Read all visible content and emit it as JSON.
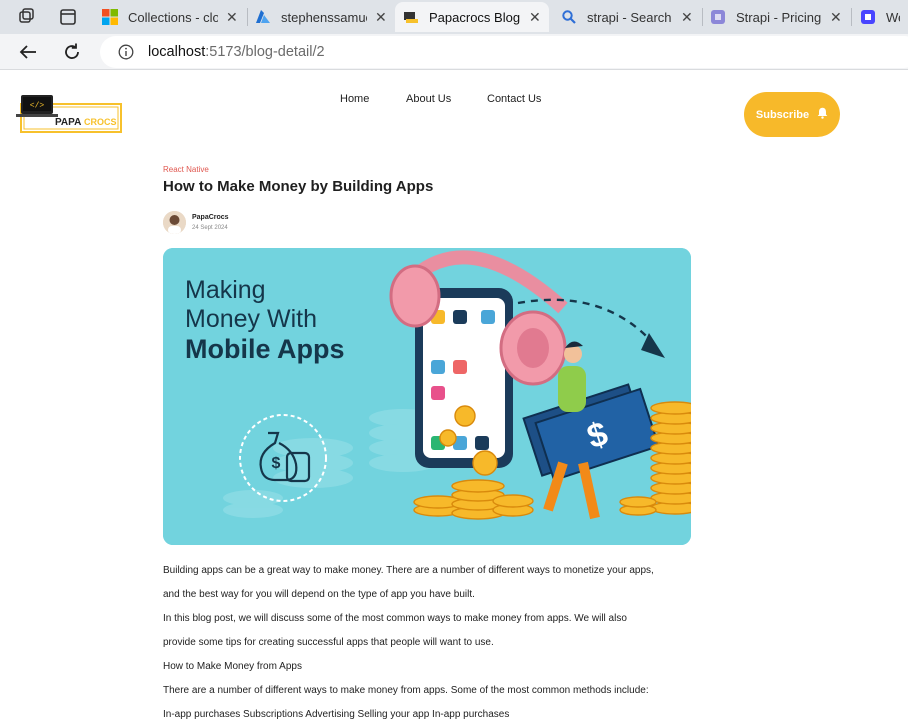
{
  "browser": {
    "tabs": [
      {
        "title": "Collections - clo",
        "icon": "microsoft-icon"
      },
      {
        "title": "stephenssamuel",
        "icon": "azure-icon"
      },
      {
        "title": "Papacrocs Blog",
        "icon": "site-favicon",
        "active": true
      },
      {
        "title": "strapi - Search",
        "icon": "search-icon"
      },
      {
        "title": "Strapi - Pricing",
        "icon": "strapi-icon"
      },
      {
        "title": "Web",
        "icon": "strapi-icon"
      }
    ],
    "url_host": "localhost",
    "url_path": ":5173/blog-detail/2"
  },
  "site": {
    "logo_text": "PAPACROCS",
    "nav": [
      {
        "label": "Home"
      },
      {
        "label": "About Us"
      },
      {
        "label": "Contact Us"
      }
    ],
    "subscribe_label": "Subscribe",
    "accent_color": "#f7b92a"
  },
  "article": {
    "category": "React Native",
    "title": "How to Make Money by Building Apps",
    "author": "PapaCrocs",
    "date": "24 Sept 2024",
    "hero": {
      "line1": "Making",
      "line2": "Money With",
      "line3": "Mobile Apps"
    },
    "paragraphs": [
      "Building apps can be a great way to make money. There are a number of different ways to monetize your apps,",
      "and the best way for you will depend on the type of app you have built.",
      "In this blog post, we will discuss some of the most common ways to make money from apps. We will also",
      "provide some tips for creating successful apps that people will want to use.",
      "How to Make Money from Apps",
      "There are a number of different ways to make money from apps. Some of the most common methods include:",
      "In-app purchases Subscriptions Advertising Selling your app In-app purchases"
    ]
  }
}
